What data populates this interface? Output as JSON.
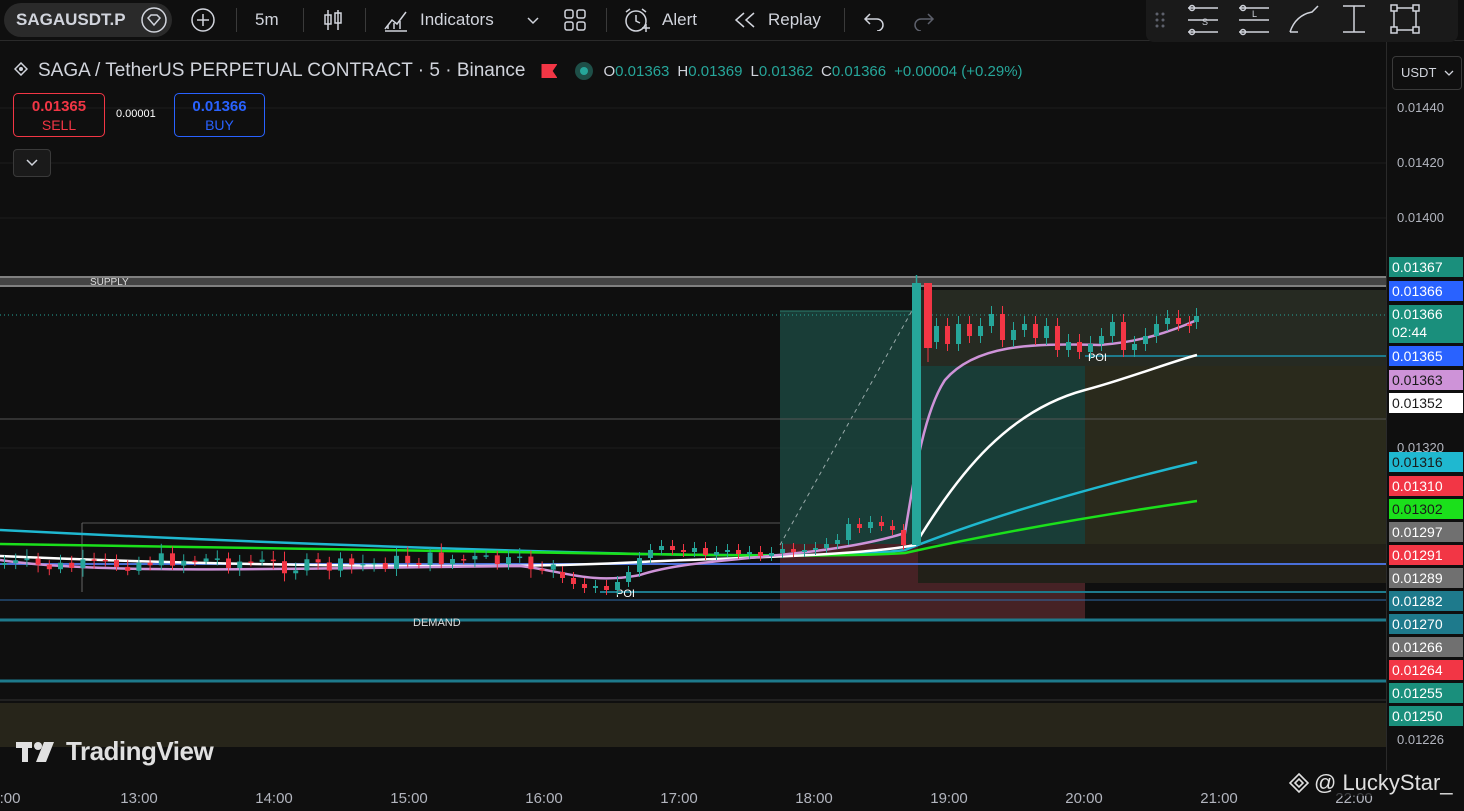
{
  "topbar": {
    "symbol": "SAGAUSDT.P",
    "interval": "5m",
    "indicators_label": "Indicators",
    "alert_label": "Alert",
    "replay_label": "Replay"
  },
  "legend": {
    "title": "SAGA / TetherUS PERPETUAL CONTRACT · 5 · Binance",
    "o_label": "O",
    "o": "0.01363",
    "h_label": "H",
    "h": "0.01369",
    "l_label": "L",
    "l": "0.01362",
    "c_label": "C",
    "c": "0.01366",
    "change": "+0.00004 (+0.29%)"
  },
  "trade": {
    "sell_price": "0.01365",
    "sell_label": "SELL",
    "spread": "0.00001",
    "buy_price": "0.01366",
    "buy_label": "BUY"
  },
  "currency": "USDT",
  "annotations": {
    "supply": "SUPPLY",
    "demand": "DEMAND",
    "poi": "POI"
  },
  "axis_ticks": [
    "0.01440",
    "0.01420",
    "0.01400",
    "0.01320",
    "0.01226"
  ],
  "price_labels": [
    {
      "value": "0.01367",
      "bg": "#1a8f7c",
      "fg": "#ffffff"
    },
    {
      "value": "0.01366",
      "bg": "#2962ff",
      "fg": "#ffffff"
    },
    {
      "value": "0.01366",
      "extra": "02:44",
      "bg": "#1a8f7c",
      "fg": "#ffffff"
    },
    {
      "value": "0.01365",
      "bg": "#2962ff",
      "fg": "#ffffff"
    },
    {
      "value": "0.01363",
      "bg": "#ce93d8",
      "fg": "#1a1a1a"
    },
    {
      "value": "0.01352",
      "bg": "#ffffff",
      "fg": "#1a1a1a"
    },
    {
      "value": "0.01316",
      "bg": "#1fb8d0",
      "fg": "#1a1a1a"
    },
    {
      "value": "0.01310",
      "bg": "#f23645",
      "fg": "#ffffff"
    },
    {
      "value": "0.01302",
      "bg": "#1be01b",
      "fg": "#1a1a1a"
    },
    {
      "value": "0.01297",
      "bg": "#707070",
      "fg": "#ffffff"
    },
    {
      "value": "0.01291",
      "bg": "#f23645",
      "fg": "#ffffff"
    },
    {
      "value": "0.01289",
      "bg": "#707070",
      "fg": "#ffffff"
    },
    {
      "value": "0.01282",
      "bg": "#1e7a8c",
      "fg": "#ffffff"
    },
    {
      "value": "0.01270",
      "bg": "#1e7a8c",
      "fg": "#ffffff"
    },
    {
      "value": "0.01266",
      "bg": "#707070",
      "fg": "#ffffff"
    },
    {
      "value": "0.01264",
      "bg": "#f23645",
      "fg": "#ffffff"
    },
    {
      "value": "0.01255",
      "bg": "#1a8f7c",
      "fg": "#ffffff"
    },
    {
      "value": "0.01250",
      "bg": "#1a8f7c",
      "fg": "#ffffff"
    }
  ],
  "time_labels": [
    "13:00",
    "14:00",
    "15:00",
    "16:00",
    "17:00",
    "18:00",
    "19:00",
    "20:00",
    "21:00",
    "22:00"
  ],
  "time_label_partial": ":00",
  "branding": {
    "logo": "TradingView",
    "watermark": "@ LuckyStar_"
  },
  "colors": {
    "up": "#26a69a",
    "down": "#f23645",
    "ema_fast": "#ce93d8",
    "ema_mid": "#ffffff",
    "ema_slow": "#1fb8d0",
    "ema_long": "#1be01b"
  }
}
